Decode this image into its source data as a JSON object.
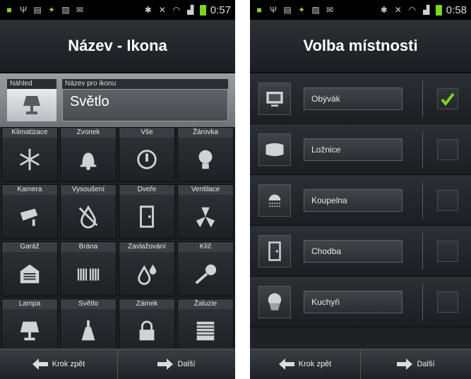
{
  "left_screen": {
    "status": {
      "time": "0:57"
    },
    "title": "Název - Ikona",
    "preview_label": "Náhled",
    "name_label": "Název pro ikonu",
    "name_value": "Světlo",
    "icons": [
      {
        "label": "Klimatizace",
        "icon": "snowflake-icon"
      },
      {
        "label": "Zvonek",
        "icon": "bell-icon"
      },
      {
        "label": "Vše",
        "icon": "power-icon"
      },
      {
        "label": "Žárovka",
        "icon": "bulb-icon"
      },
      {
        "label": "Kamera",
        "icon": "camera-icon"
      },
      {
        "label": "Vysoušení",
        "icon": "no-drop-icon"
      },
      {
        "label": "Dveře",
        "icon": "door-icon"
      },
      {
        "label": "Ventilace",
        "icon": "fan-icon"
      },
      {
        "label": "Garáž",
        "icon": "garage-icon"
      },
      {
        "label": "Brána",
        "icon": "gate-icon"
      },
      {
        "label": "Zavlažování",
        "icon": "water-icon"
      },
      {
        "label": "Klíč",
        "icon": "key-icon"
      },
      {
        "label": "Lampa",
        "icon": "lamp-icon"
      },
      {
        "label": "Světlo",
        "icon": "ceiling-light-icon"
      },
      {
        "label": "Zámek",
        "icon": "lock-icon"
      },
      {
        "label": "Žaluzie",
        "icon": "blinds-icon"
      }
    ],
    "back_label": "Krok zpět",
    "next_label": "Další"
  },
  "right_screen": {
    "status": {
      "time": "0:58"
    },
    "title": "Volba místnosti",
    "rooms": [
      {
        "name": "Obývák",
        "icon": "tv-icon",
        "checked": true
      },
      {
        "name": "Ložnice",
        "icon": "pillow-icon",
        "checked": false
      },
      {
        "name": "Koupelna",
        "icon": "shower-icon",
        "checked": false
      },
      {
        "name": "Chodba",
        "icon": "door-icon",
        "checked": false
      },
      {
        "name": "Kuchyň",
        "icon": "muffin-icon",
        "checked": false
      }
    ],
    "back_label": "Krok zpět",
    "next_label": "Další"
  },
  "colors": {
    "check": "#7ed321",
    "battery": "#7ed321"
  }
}
